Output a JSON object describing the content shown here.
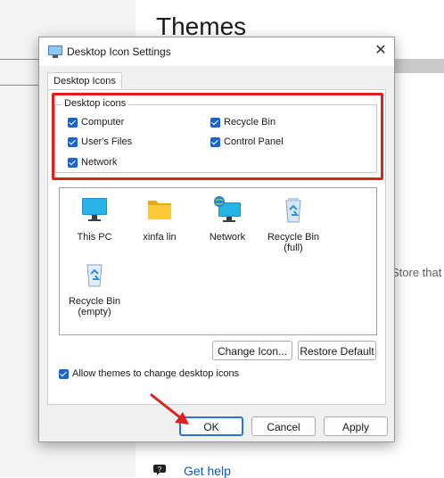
{
  "background": {
    "title": "Themes",
    "store_text": "Store that",
    "get_help": "Get help",
    "colors": {
      "sidebar": "#f3f3f3",
      "link": "#0b5cad"
    }
  },
  "dialog": {
    "title": "Desktop Icon Settings",
    "close_glyph": "✕",
    "tab": "Desktop Icons",
    "group_title": "Desktop icons",
    "checkboxes": [
      {
        "label": "Computer",
        "checked": true
      },
      {
        "label": "Recycle Bin",
        "checked": true
      },
      {
        "label": "User's Files",
        "checked": true
      },
      {
        "label": "Control Panel",
        "checked": true
      },
      {
        "label": "Network",
        "checked": true
      }
    ],
    "icons": [
      {
        "label": "This PC",
        "icon": "monitor-icon"
      },
      {
        "label": "xinfa lin",
        "icon": "folder-icon"
      },
      {
        "label": "Network",
        "icon": "network-icon"
      },
      {
        "label_line1": "Recycle Bin",
        "label_line2": "(full)",
        "icon": "recycle-bin-full-icon"
      },
      {
        "label_line1": "Recycle Bin",
        "label_line2": "(empty)",
        "icon": "recycle-bin-empty-icon"
      }
    ],
    "change_icon": "Change Icon...",
    "restore_default": "Restore Default",
    "allow_themes": {
      "label": "Allow themes to change desktop icons",
      "checked": true
    },
    "ok": "OK",
    "cancel": "Cancel",
    "apply": "Apply",
    "colors": {
      "accent": "#1f63c4",
      "highlight_box": "#e0201f",
      "arrow": "#e0201f"
    }
  }
}
